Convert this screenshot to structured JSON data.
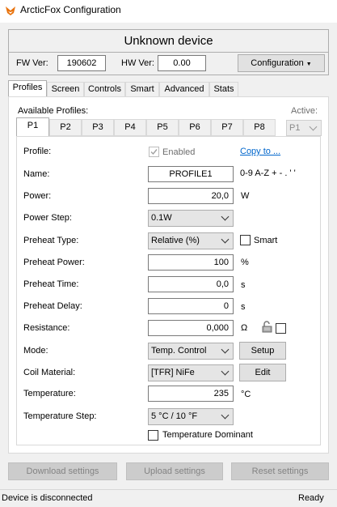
{
  "window": {
    "title": "ArcticFox Configuration"
  },
  "device": {
    "name": "Unknown device"
  },
  "header": {
    "fw_label": "FW Ver:",
    "fw_value": "190602",
    "hw_label": "HW Ver:",
    "hw_value": "0.00",
    "config_button": "Configuration"
  },
  "tabs": [
    "Profiles",
    "Screen",
    "Controls",
    "Smart",
    "Advanced",
    "Stats"
  ],
  "profiles": {
    "available_label": "Available Profiles:",
    "active_label": "Active:",
    "active_value": "P1",
    "tabs": [
      "P1",
      "P2",
      "P3",
      "P4",
      "P5",
      "P6",
      "P7",
      "P8"
    ]
  },
  "form": {
    "profile_label": "Profile:",
    "enabled_label": "Enabled",
    "copy_link": "Copy to ...",
    "name_label": "Name:",
    "name_value": "PROFILE1",
    "name_hint": "0-9 A-Z + - . ' '",
    "power_label": "Power:",
    "power_value": "20,0",
    "power_unit": "W",
    "power_step_label": "Power Step:",
    "power_step_value": "0.1W",
    "preheat_type_label": "Preheat Type:",
    "preheat_type_value": "Relative (%)",
    "smart_label": "Smart",
    "preheat_power_label": "Preheat Power:",
    "preheat_power_value": "100",
    "preheat_power_unit": "%",
    "preheat_time_label": "Preheat Time:",
    "preheat_time_value": "0,0",
    "preheat_time_unit": "s",
    "preheat_delay_label": "Preheat Delay:",
    "preheat_delay_value": "0",
    "preheat_delay_unit": "s",
    "resistance_label": "Resistance:",
    "resistance_value": "0,000",
    "resistance_unit": "Ω",
    "mode_label": "Mode:",
    "mode_value": "Temp. Control",
    "setup_button": "Setup",
    "coil_label": "Coil Material:",
    "coil_value": "[TFR] NiFe",
    "edit_button": "Edit",
    "temp_label": "Temperature:",
    "temp_value": "235",
    "temp_unit": "°C",
    "temp_step_label": "Temperature Step:",
    "temp_step_value": "5 °C / 10 °F",
    "temp_dominant_label": "Temperature Dominant"
  },
  "actions": {
    "download": "Download settings",
    "upload": "Upload settings",
    "reset": "Reset settings"
  },
  "status": {
    "left": "Device is disconnected",
    "right": "Ready"
  }
}
